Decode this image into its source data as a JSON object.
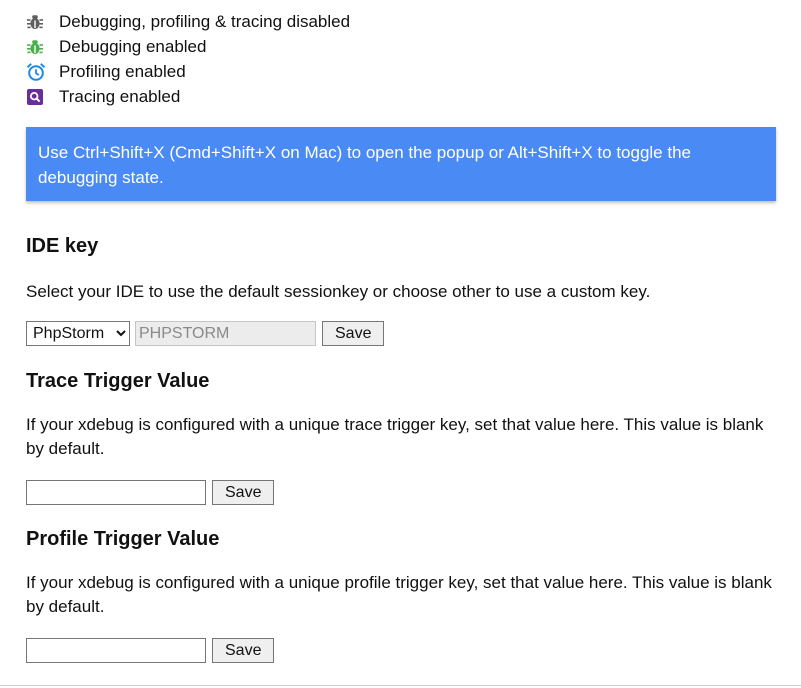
{
  "legend": [
    {
      "icon": "bug-icon-gray",
      "color": "#5f5f5f",
      "label": "Debugging, profiling & tracing disabled"
    },
    {
      "icon": "bug-icon-green",
      "color": "#4cae4c",
      "label": "Debugging enabled"
    },
    {
      "icon": "alarm-clock-icon",
      "color": "#1e88e5",
      "label": "Profiling enabled"
    },
    {
      "icon": "trace-search-icon",
      "color": "#6a2e9a",
      "label": "Tracing enabled"
    }
  ],
  "info": {
    "text": "Use Ctrl+Shift+X (Cmd+Shift+X on Mac) to open the popup or Alt+Shift+X to toggle the debugging state.",
    "color": "#4a8af4"
  },
  "ide_key": {
    "heading": "IDE key",
    "description": "Select your IDE to use the default sessionkey or choose other to use a custom key.",
    "selected": "PhpStorm",
    "value": "PHPSTORM",
    "save_label": "Save"
  },
  "trace": {
    "heading": "Trace Trigger Value",
    "description": "If your xdebug is configured with a unique trace trigger key, set that value here. This value is blank by default.",
    "value": "",
    "save_label": "Save"
  },
  "profile": {
    "heading": "Profile Trigger Value",
    "description": "If your xdebug is configured with a unique profile trigger key, set that value here. This value is blank by default.",
    "value": "",
    "save_label": "Save"
  }
}
